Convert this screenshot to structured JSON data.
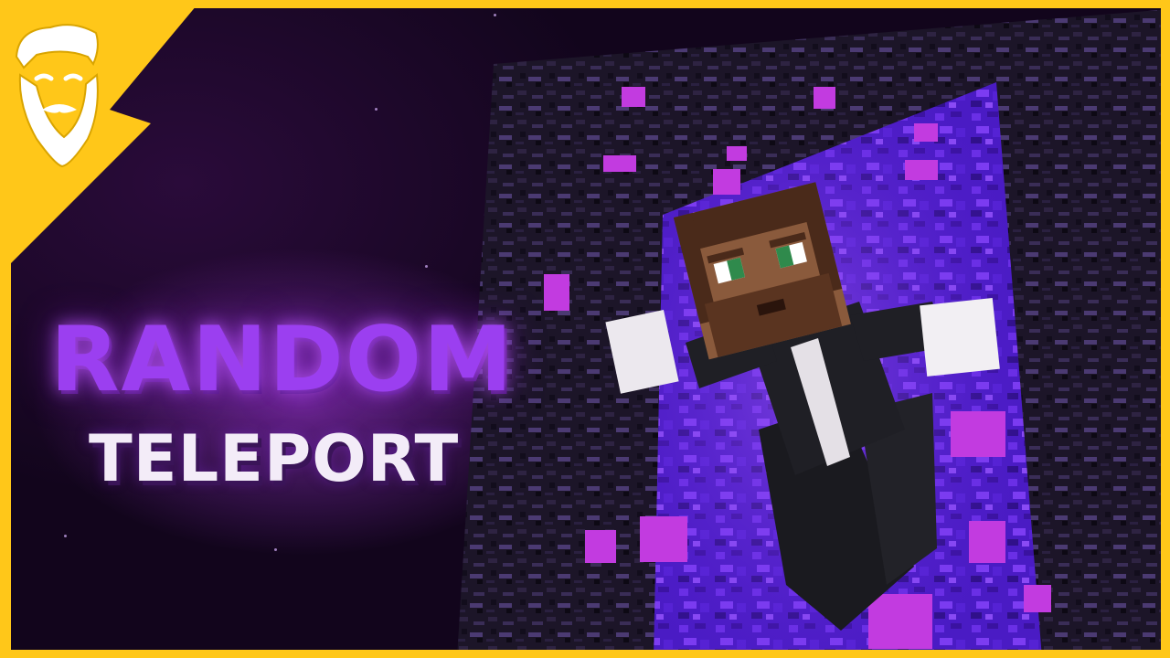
{
  "title": {
    "line1": "RANDOM",
    "line2": "TELEPORT"
  },
  "colors": {
    "frame": "#ffc719",
    "title_main": "#9b3ff0",
    "title_sub": "#f3ecf8",
    "portal": "#5a1fd6",
    "obsidian": "#1c1528"
  },
  "icons": {
    "logo": "bearded-face-logo",
    "character": "minecraft-bearded-character",
    "portal": "nether-portal"
  }
}
